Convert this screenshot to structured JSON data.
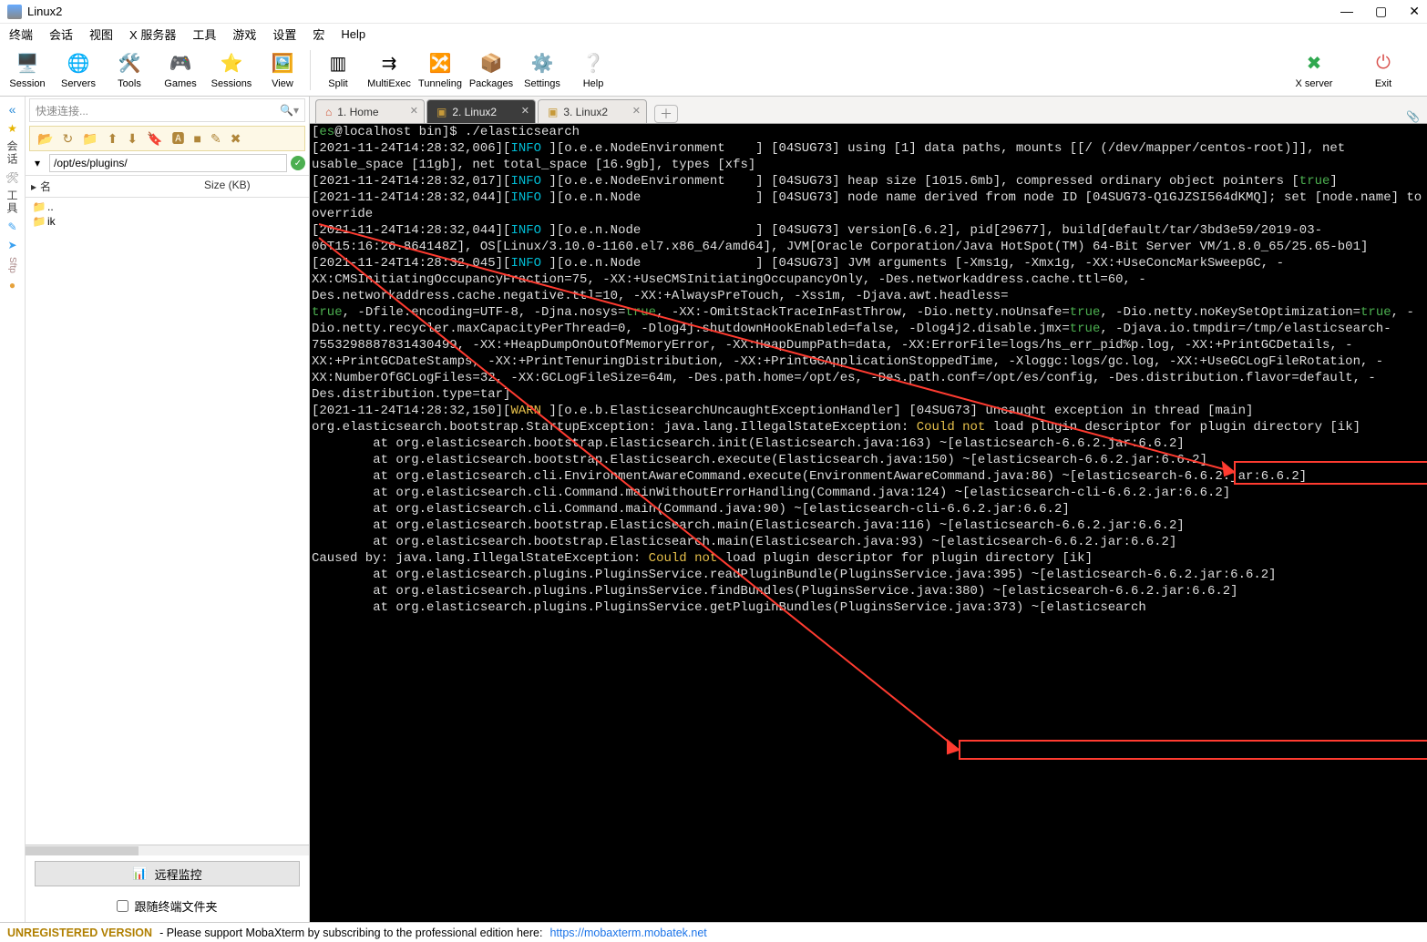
{
  "window": {
    "title": "Linux2"
  },
  "menus": [
    "终端",
    "会话",
    "视图",
    "X 服务器",
    "工具",
    "游戏",
    "设置",
    "宏",
    "Help"
  ],
  "toolbar_left": [
    {
      "icon": "🖥️",
      "label": "Session"
    },
    {
      "icon": "🌐",
      "label": "Servers"
    },
    {
      "icon": "🛠️",
      "label": "Tools"
    },
    {
      "icon": "🎮",
      "label": "Games"
    },
    {
      "icon": "⭐",
      "label": "Sessions"
    },
    {
      "icon": "🖼️",
      "label": "View"
    }
  ],
  "toolbar_mid": [
    {
      "icon": "▥",
      "label": "Split"
    },
    {
      "icon": "⇉",
      "label": "MultiExec"
    },
    {
      "icon": "🔀",
      "label": "Tunneling"
    },
    {
      "icon": "📦",
      "label": "Packages"
    },
    {
      "icon": "⚙️",
      "label": "Settings"
    },
    {
      "icon": "❔",
      "label": "Help"
    }
  ],
  "toolbar_right": [
    {
      "icon": "✖",
      "label": "X server",
      "color": "#2fa84f"
    },
    {
      "icon": "⏻",
      "label": "Exit",
      "color": "#d9534f"
    }
  ],
  "left_rail": {
    "labels": [
      "会话",
      "工具"
    ],
    "sftp": "Sftp"
  },
  "side": {
    "quick_placeholder": "快速连接...",
    "path": "/opt/es/plugins/",
    "sftp_icons": [
      "📂",
      "↻",
      "📁",
      "⬆",
      "⬇",
      "🔖",
      "🅰",
      "■",
      "✎",
      "✖"
    ],
    "columns": {
      "name": "名",
      "size": "Size (KB)"
    },
    "rows": [
      {
        "icon": "📁",
        "name": ".."
      },
      {
        "icon": "📁",
        "name": "ik"
      }
    ],
    "remote_btn": "远程监控",
    "follow": "跟随终端文件夹"
  },
  "tabs": [
    {
      "label": "1. Home",
      "active": false,
      "kind": "home"
    },
    {
      "label": "2. Linux2",
      "active": true,
      "kind": "term"
    },
    {
      "label": "3. Linux2",
      "active": false,
      "kind": "term"
    }
  ],
  "status": {
    "unreg": "UNREGISTERED VERSION",
    "msg": " -  Please support MobaXterm by subscribing to the professional edition here:  ",
    "link": "https://mobaxterm.mobatek.net"
  },
  "highlight": {
    "h1": "Could not",
    "h2": "Could not"
  },
  "terminal": {
    "prompt_user": "es",
    "prompt_host": "localhost",
    "prompt_cwd": "bin",
    "cmd": "./elasticsearch",
    "lines": [
      {
        "ts": "[2021-11-24T14:28:32,006]",
        "lvl": "INFO",
        "src": "[o.e.e.NodeEnvironment    ]",
        "msg": " [04SUG73] using [1] data paths, mounts [[/ (/dev/mapper/centos-root)]], net usable_space [11gb], net total_space [16.9gb], types [xfs]"
      },
      {
        "ts": "[2021-11-24T14:28:32,017]",
        "lvl": "INFO",
        "src": "[o.e.e.NodeEnvironment    ]",
        "msg": " [04SUG73] heap size [1015.6mb], compressed ordinary object pointers ",
        "tail_true": "[true]"
      },
      {
        "ts": "[2021-11-24T14:28:32,044]",
        "lvl": "INFO",
        "src": "[o.e.n.Node               ]",
        "msg": " [04SUG73] node name derived from node ID [04SUG73-Q1GJZSI564dKMQ]; set [node.name] to override"
      },
      {
        "ts": "[2021-11-24T14:28:32,044]",
        "lvl": "INFO",
        "src": "[o.e.n.Node               ]",
        "msg": " [04SUG73] version[6.6.2], pid[29677], build[default/tar/3bd3e59/2019-03-06T15:16:26.864148Z], OS[Linux/3.10.0-1160.el7.x86_64/amd64], JVM[Oracle Corporation/Java HotSpot(TM) 64-Bit Server VM/1.8.0_65/25.65-b01]"
      },
      {
        "ts": "[2021-11-24T14:28:32,045]",
        "lvl": "INFO",
        "src": "[o.e.n.Node               ]",
        "msg": " [04SUG73] JVM arguments [-Xms1g, -Xmx1g, -XX:+UseConcMarkSweepGC, -XX:CMSInitiatingOccupancyFraction=75, -XX:+UseCMSInitiatingOccupancyOnly, -Des.networkaddress.cache.ttl=60, -Des.networkaddress.cache.negative.ttl=10, -XX:+AlwaysPreTouch, -Xss1m, -Djava.awt.headless="
      },
      {
        "raw_true_run": "true, -Dfile.encoding=UTF-8, -Djna.nosys=true, -XX:-OmitStackTraceInFastThrow, -Dio.netty.noUnsafe=true, -Dio.netty.noKeySetOptimization=true, -Dio.netty.recycler.maxCapacityPerThread=0, -Dlog4j.shutdownHookEnabled=false, -Dlog4j2.disable.jmx=true, -Djava.io.tmpdir=/tmp/elasticsearch-7553298887831430499, -XX:+HeapDumpOnOutOfMemoryError, -XX:HeapDumpPath=data, -XX:ErrorFile=logs/hs_err_pid%p.log, -XX:+PrintGCDetails, -XX:+PrintGCDateStamps, -XX:+PrintTenuringDistribution, -XX:+PrintGCApplicationStoppedTime, -Xloggc:logs/gc.log, -XX:+UseGCLogFileRotation, -XX:NumberOfGCLogFiles=32, -XX:GCLogFileSize=64m, -Des.path.home=/opt/es, -Des.path.conf=/opt/es/config, -Des.distribution.flavor=default, -Des.distribution.type=tar]"
      },
      {
        "ts": "[2021-11-24T14:28:32,150]",
        "lvl": "WARN",
        "src": "[o.e.b.ElasticsearchUncaughtExceptionHandler]",
        "msg": " [04SUG73] uncaught exception in thread [main]"
      },
      {
        "plain": "org.elasticsearch.bootstrap.StartupException: java.lang.IllegalStateException: ",
        "hl": "Could not",
        "plain2": " load plugin descriptor for plugin directory [ik]"
      },
      {
        "plain": "        at org.elasticsearch.bootstrap.Elasticsearch.init(Elasticsearch.java:163) ~[elasticsearch-6.6.2.jar:6.6.2]"
      },
      {
        "plain": "        at org.elasticsearch.bootstrap.Elasticsearch.execute(Elasticsearch.java:150) ~[elasticsearch-6.6.2.jar:6.6.2]"
      },
      {
        "plain": "        at org.elasticsearch.cli.EnvironmentAwareCommand.execute(EnvironmentAwareCommand.java:86) ~[elasticsearch-6.6.2.jar:6.6.2]"
      },
      {
        "plain": "        at org.elasticsearch.cli.Command.mainWithoutErrorHandling(Command.java:124) ~[elasticsearch-cli-6.6.2.jar:6.6.2]"
      },
      {
        "plain": "        at org.elasticsearch.cli.Command.main(Command.java:90) ~[elasticsearch-cli-6.6.2.jar:6.6.2]"
      },
      {
        "plain": "        at org.elasticsearch.bootstrap.Elasticsearch.main(Elasticsearch.java:116) ~[elasticsearch-6.6.2.jar:6.6.2]"
      },
      {
        "plain": "        at org.elasticsearch.bootstrap.Elasticsearch.main(Elasticsearch.java:93) ~[elasticsearch-6.6.2.jar:6.6.2]"
      },
      {
        "plain": "Caused by: java.lang.IllegalStateException: ",
        "hl": "Could not",
        "plain2": " load plugin descriptor for plugin directory [ik]"
      },
      {
        "plain": "        at org.elasticsearch.plugins.PluginsService.readPluginBundle(PluginsService.java:395) ~[elasticsearch-6.6.2.jar:6.6.2]"
      },
      {
        "plain": "        at org.elasticsearch.plugins.PluginsService.findBundles(PluginsService.java:380) ~[elasticsearch-6.6.2.jar:6.6.2]"
      },
      {
        "plain": "        at org.elasticsearch.plugins.PluginsService.getPluginBundles(PluginsService.java:373) ~[elasticsearch"
      }
    ]
  }
}
